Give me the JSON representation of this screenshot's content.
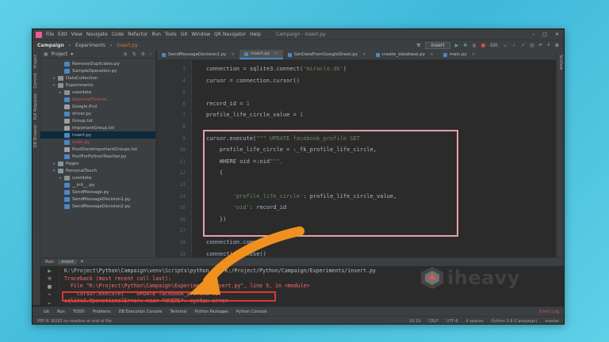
{
  "menubar": {
    "items": [
      "File",
      "Edit",
      "View",
      "Navigate",
      "Code",
      "Refactor",
      "Run",
      "Tools",
      "Git",
      "Window",
      "QR Navigator",
      "Help"
    ],
    "window_title": "Campaign - insert.py"
  },
  "navbar": {
    "crumbs": [
      "Campaign",
      "Experiments",
      "insert.py"
    ],
    "run_config": "insert",
    "git_label": "Git:"
  },
  "project": {
    "header": "Project",
    "tree": [
      {
        "label": "RemoveDuplicates.py",
        "type": "py",
        "indent": 3
      },
      {
        "label": "SampleOperation.py",
        "type": "py",
        "indent": 3
      },
      {
        "label": "DataCollection",
        "type": "folder",
        "indent": 2,
        "arrow": "▸"
      },
      {
        "label": "Experiments",
        "type": "folder",
        "indent": 2,
        "arrow": "▾"
      },
      {
        "label": "userdata",
        "type": "folder",
        "indent": 3,
        "arrow": "▸"
      },
      {
        "label": "ApproveFinalize...",
        "type": "py",
        "indent": 3,
        "err": true
      },
      {
        "label": "Google.Pcd",
        "type": "txt",
        "indent": 3
      },
      {
        "label": "driver.py",
        "type": "py",
        "indent": 3
      },
      {
        "label": "Group.txt",
        "type": "txt",
        "indent": 3
      },
      {
        "label": "ImportantGroup.txt",
        "type": "txt",
        "indent": 3
      },
      {
        "label": "insert.py",
        "type": "py",
        "indent": 3,
        "sel": true
      },
      {
        "label": "main.py",
        "type": "py",
        "indent": 3,
        "err": true
      },
      {
        "label": "PostDoneImportantGroups.txt",
        "type": "txt",
        "indent": 3
      },
      {
        "label": "PostForPythonTeacher.py",
        "type": "py",
        "indent": 3
      },
      {
        "label": "Pages",
        "type": "folder",
        "indent": 2,
        "arrow": "▸"
      },
      {
        "label": "PersonalTouch",
        "type": "folder",
        "indent": 2,
        "arrow": "▾"
      },
      {
        "label": "userdata",
        "type": "folder",
        "indent": 3,
        "arrow": "▸"
      },
      {
        "label": "__init__.py",
        "type": "py",
        "indent": 3
      },
      {
        "label": "SendMessage.py",
        "type": "py",
        "indent": 3
      },
      {
        "label": "SendMessageDecision1.py",
        "type": "py",
        "indent": 3
      },
      {
        "label": "SendMessageDecision2.py",
        "type": "py",
        "indent": 3
      }
    ]
  },
  "editor": {
    "tabs": [
      {
        "label": "SendMessageDecision1.py",
        "active": false
      },
      {
        "label": "insert.py",
        "active": true
      },
      {
        "label": "GetDataFromGoogleSheet.py",
        "active": false
      },
      {
        "label": "create_database.py",
        "active": false
      },
      {
        "label": "main.py",
        "active": false
      }
    ],
    "line_numbers": [
      "3",
      "4",
      "5",
      "6",
      "7",
      "8",
      "9",
      "10",
      "11",
      "12",
      "13",
      "14",
      "15",
      "16",
      "17",
      "18"
    ],
    "lines": [
      {
        "n": "3",
        "text": "connection = sqlite3.connect('miracle.db')"
      },
      {
        "n": "4",
        "text": "cursor = connection.cursor()"
      },
      {
        "n": "5",
        "text": ""
      },
      {
        "n": "6",
        "text": "record_id = 1"
      },
      {
        "n": "7",
        "text": "profile_life_circle_value = 1"
      },
      {
        "n": "8",
        "text": ""
      },
      {
        "n": "9",
        "text": "cursor.execute(\"\"\" UPDATE facebook_profile SET"
      },
      {
        "n": "10",
        "text": "    profile_life_circle = :_fk_profile_life_circle,"
      },
      {
        "n": "11",
        "text": "    WHERE oid =:oid\"\"\","
      },
      {
        "n": "12",
        "text": "    {"
      },
      {
        "n": "13",
        "text": ""
      },
      {
        "n": "14",
        "text": "        'profile_life_circle': profile_life_circle_value,"
      },
      {
        "n": "15",
        "text": "        'oid': record_id"
      },
      {
        "n": "16",
        "text": "    })"
      },
      {
        "n": "17",
        "text": ""
      },
      {
        "n": "18",
        "text": "connection.commit()"
      },
      {
        "n": "19",
        "text": "connection.close()"
      }
    ]
  },
  "run_panel": {
    "label": "Run:",
    "tab": "insert",
    "console": [
      {
        "style": "normal",
        "text": "K:\\Project\\Python\\Campaign\\venv\\Scripts\\python.exe K:/Project/Python/Campaign/Experiments/insert.py"
      },
      {
        "style": "err",
        "text": "Traceback (most recent call last):"
      },
      {
        "style": "err",
        "text": "  File \"K:\\Project\\Python\\Campaign\\Experiments\\insert.py\", line 9, in <module>"
      },
      {
        "style": "err",
        "text": "    cursor.execute(\"\"\" UPDATE facebook_profile SET"
      },
      {
        "style": "err",
        "text": "sqlite3.OperationalError: near \"WHERE\": syntax error"
      }
    ]
  },
  "bottom_tabs": [
    "Git",
    "Run",
    "TODO",
    "Problems",
    "DB Execution Console",
    "Terminal",
    "Python Packages",
    "Python Console"
  ],
  "event_log": "Event Log",
  "status": {
    "left": "PEP 8: W292 no newline at end of file",
    "position": "18:19",
    "line_ending": "CRLF",
    "encoding": "UTF-8",
    "indent": "4 spaces",
    "interpreter": "Python 3.9 (Campaign)",
    "branch": "master"
  },
  "watermark": {
    "text": "iheavy"
  },
  "colors": {
    "highlight_box": "#e8a0a7",
    "error_box": "#d63a3a",
    "arrow": "#f0901e"
  }
}
